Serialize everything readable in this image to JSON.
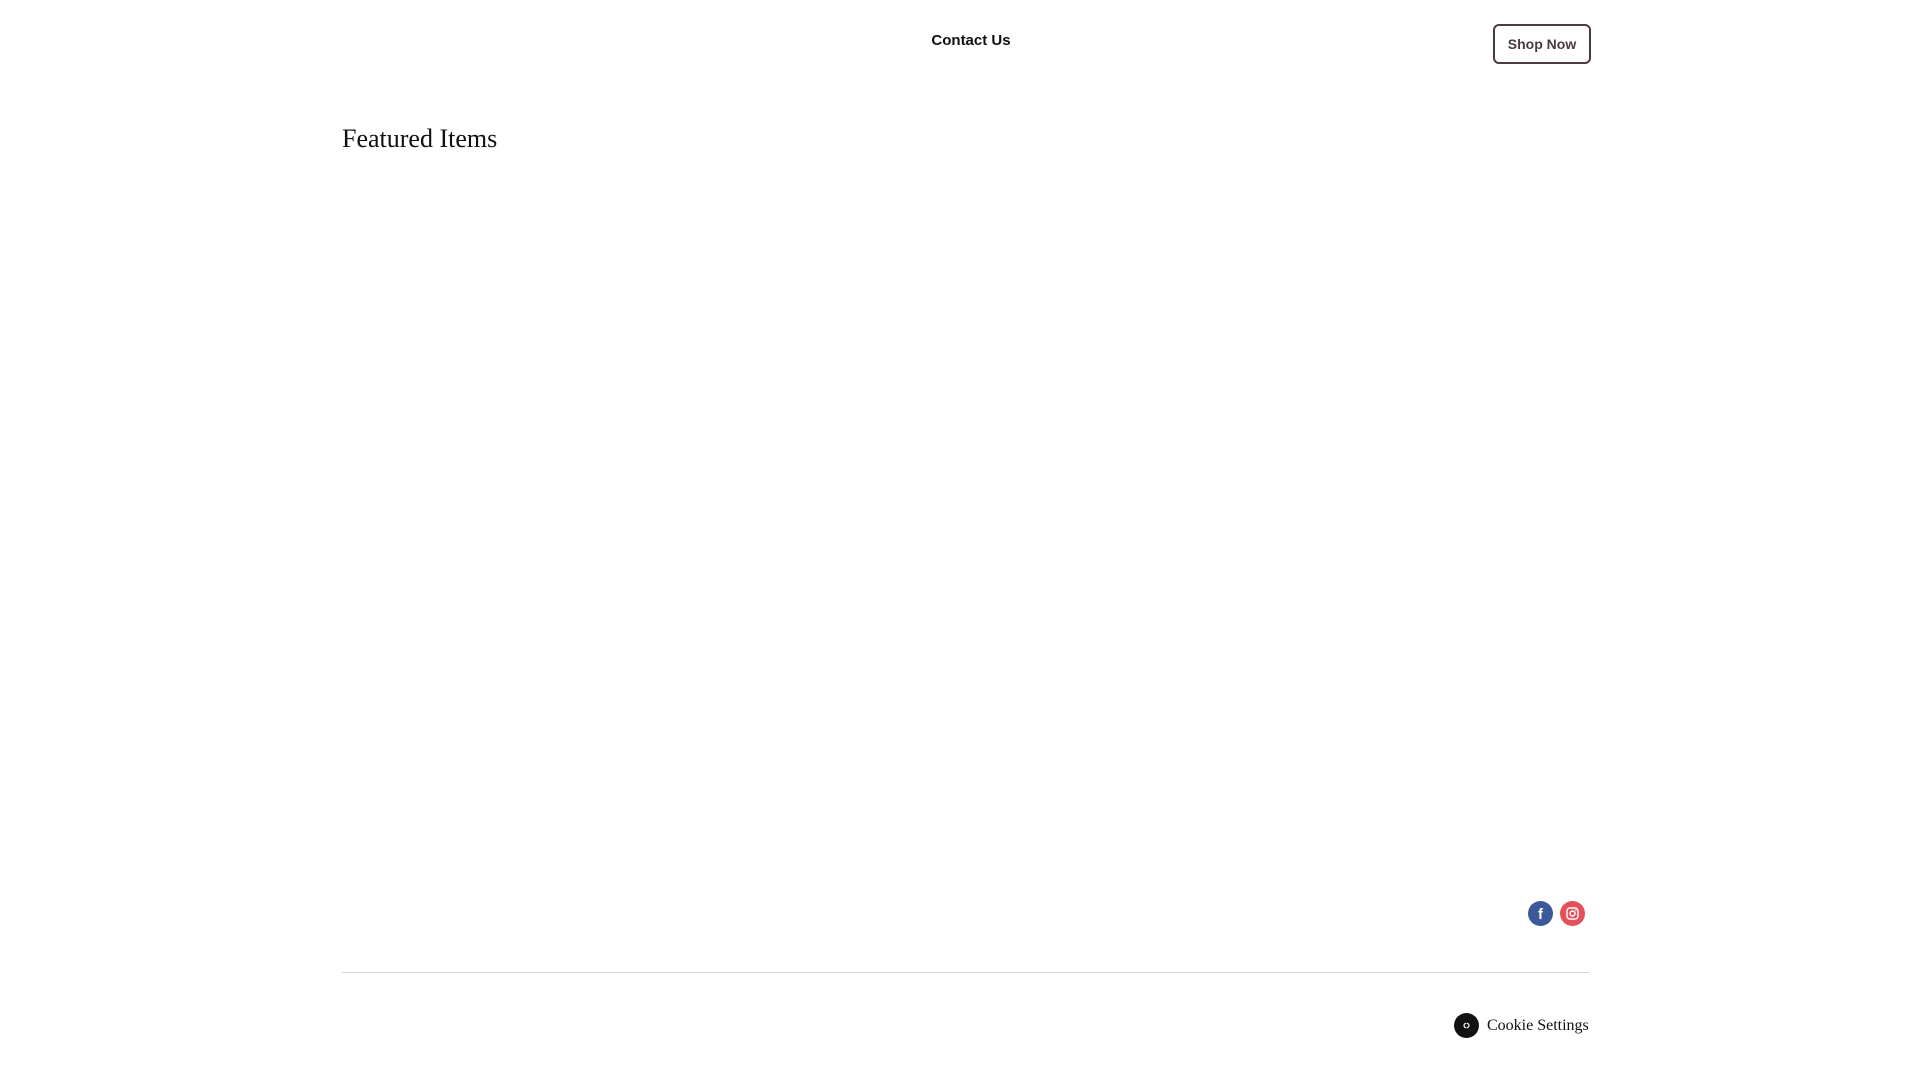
{
  "header": {
    "nav_link": "Contact Us",
    "cta_label": "Shop Now"
  },
  "main": {
    "section_title": "Featured Items"
  },
  "social": {
    "items": [
      {
        "name": "facebook",
        "icon": "facebook-icon",
        "color": "#3b5998"
      },
      {
        "name": "instagram",
        "icon": "instagram-icon",
        "color": "#e4505a"
      }
    ]
  },
  "footer": {
    "cookie_label": "Cookie Settings"
  },
  "colors": {
    "cta_border": "#4a3b3f",
    "text": "#111111",
    "divider": "#d6d6d6"
  }
}
